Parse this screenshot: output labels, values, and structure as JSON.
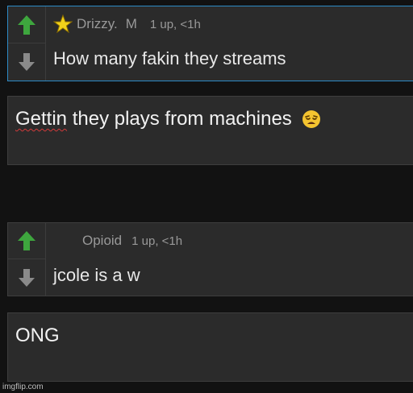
{
  "comments": [
    {
      "username": "Drizzy.",
      "mod_flag": "M",
      "upvotes": "1 up, <1h",
      "text": "How many fakin they streams",
      "has_star": true,
      "star_icon": "star-icon",
      "up_icon": "upvote-arrow-icon",
      "down_icon": "downvote-arrow-icon"
    },
    {
      "username": "Opioid",
      "upvotes": "1 up, <1h",
      "text": "jcole is a w",
      "up_icon": "upvote-arrow-icon",
      "down_icon": "downvote-arrow-icon"
    }
  ],
  "replies": [
    {
      "misspelled_word": "Gettin",
      "rest": " they plays from machines",
      "emoji_icon": "weary-face-emoji-icon"
    },
    {
      "text": "ONG"
    }
  ],
  "watermark": "imgflip.com",
  "colors": {
    "background": "#121212",
    "panel": "#2b2b2b",
    "upvote_green": "#3ea63e",
    "downvote_gray": "#8a8a8a",
    "active_border": "#2d8bc6",
    "star_yellow": "#f2d21a"
  }
}
